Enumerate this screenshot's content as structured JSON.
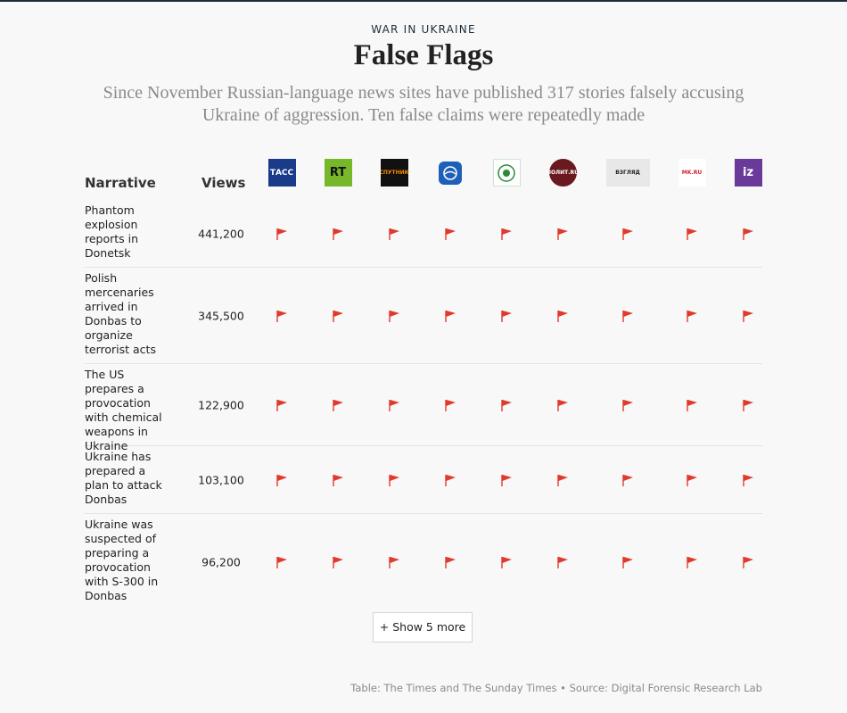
{
  "header": {
    "kicker": "WAR IN UKRAINE",
    "title": "False Flags",
    "subtitle": "Since November Russian-language news sites have published 317 stories falsely accusing Ukraine of  aggression. Ten false claims were repeatedly made"
  },
  "table": {
    "col_narrative": "Narrative",
    "col_views": "Views",
    "outlets": [
      {
        "icon": "tass-logo",
        "text": "ТАСС",
        "bg": "#1a3a8a",
        "fg": "#ffffff"
      },
      {
        "icon": "rt-logo",
        "text": "RT",
        "bg": "#77b82a",
        "fg": "#111111"
      },
      {
        "icon": "sputnik-logo",
        "text": "СПУТНИК",
        "bg": "#111111",
        "fg": "#f28c00"
      },
      {
        "icon": "ria-logo",
        "text": "",
        "bg": "#1e5fb8",
        "fg": "#ffffff"
      },
      {
        "icon": "emblem-logo",
        "text": "",
        "bg": "#ffffff",
        "fg": "#2a8a3a"
      },
      {
        "icon": "dark-round-logo",
        "text": "ПОЛИТ.RU",
        "bg": "#6a1a1e",
        "fg": "#ffffff"
      },
      {
        "icon": "vzglyad-logo",
        "text": "ВЗГЛЯД",
        "bg": "#e8e8e8",
        "fg": "#222222"
      },
      {
        "icon": "mk-logo",
        "text": "MK.RU",
        "bg": "#ffffff",
        "fg": "#d2232a"
      },
      {
        "icon": "iz-logo",
        "text": "iz",
        "bg": "#6a3a9a",
        "fg": "#ffffff"
      }
    ],
    "rows": [
      {
        "narrative": "Phantom explosion reports in Donetsk",
        "views": "441,200"
      },
      {
        "narrative": "Polish mercenaries arrived in Donbas to organize terrorist acts",
        "views": "345,500"
      },
      {
        "narrative": "The US prepares a provocation with chemical weapons in Ukraine",
        "views": "122,900"
      },
      {
        "narrative": "Ukraine has prepared a plan to attack Donbas",
        "views": "103,100"
      },
      {
        "narrative": "Ukraine was suspected of preparing a provocation with S-300 in Donbas",
        "views": "96,200"
      }
    ],
    "flag_color": "#e03a2c"
  },
  "show_more_label": "+ Show 5 more",
  "source": "Table: The Times and The Sunday Times • Source: Digital Forensic Research Lab"
}
